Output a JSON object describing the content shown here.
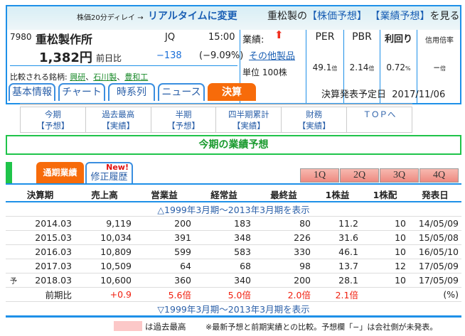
{
  "header": {
    "delay_note": "株価20分ディレイ →",
    "realtime_link": "リアルタイムに変更",
    "view_prefix": "重松製の",
    "stock_forecast_link": "【株価予想】",
    "earnings_forecast_link": "【業績予想】",
    "view_suffix": "を見る"
  },
  "stock": {
    "code": "7980",
    "name": "重松製作所",
    "market": "JQ",
    "time": "15:00",
    "price": "1,382円",
    "change_label": "前日比",
    "change": "−138",
    "change_pct": "(−9.09%)",
    "compare_label": "比較される銘柄:",
    "compare": [
      "興研",
      "石川製",
      "豊和工"
    ],
    "sep": "、"
  },
  "info": {
    "earnings_label": "業績:",
    "sector_link": "その他製品",
    "unit": "単位 100株"
  },
  "metrics": [
    {
      "label": "PER",
      "value": "49.1",
      "unit": "倍"
    },
    {
      "label": "PBR",
      "value": "2.14",
      "unit": "倍"
    },
    {
      "label": "利回り",
      "value": "0.72",
      "unit": "%"
    },
    {
      "label": "信用倍率",
      "value": "−",
      "unit": "倍"
    }
  ],
  "tabs": [
    "基本情報",
    "チャート",
    "時系列",
    "ニュース",
    "決算"
  ],
  "announce": {
    "label": "決算発表予定日",
    "date": "2017/11/06"
  },
  "subnav": [
    [
      "今期",
      "【予想】"
    ],
    [
      "過去最高",
      "【実績】"
    ],
    [
      "半期",
      "【予想】"
    ],
    [
      "四半期累計",
      "【実績】"
    ],
    [
      "財務",
      "【実績】"
    ],
    [
      "ＴＯＰへ",
      ""
    ]
  ],
  "section_title": "今期の業績予想",
  "subtabs": {
    "annual": "通期業績",
    "new": "New!",
    "revisions": "修正履歴"
  },
  "quarters": [
    "1Q",
    "2Q",
    "3Q",
    "4Q"
  ],
  "table": {
    "headers": [
      "決算期",
      "売上高",
      "営業益",
      "経常益",
      "最終益",
      "1株益",
      "1株配",
      "発表日"
    ],
    "expand_top": "△1999年3月期～2013年3月期を表示",
    "rows": [
      [
        "",
        "2014.03",
        "9,119",
        "200",
        "183",
        "80",
        "11.2",
        "10",
        "14/05/09"
      ],
      [
        "",
        "2015.03",
        "10,034",
        "391",
        "348",
        "226",
        "31.6",
        "10",
        "15/05/08"
      ],
      [
        "",
        "2016.03",
        "10,809",
        "599",
        "583",
        "330",
        "46.1",
        "10",
        "16/05/10"
      ],
      [
        "",
        "2017.03",
        "10,509",
        "64",
        "68",
        "98",
        "13.7",
        "12",
        "17/05/09"
      ],
      [
        "予",
        "2018.03",
        "10,600",
        "360",
        "340",
        "200",
        "28.1",
        "10",
        "17/05/09"
      ]
    ],
    "compare_row": [
      "前期比",
      "+0.9",
      "5.6倍",
      "5.0倍",
      "2.0倍",
      "2.1倍",
      "",
      "(%)"
    ],
    "expand_bottom": "▽1999年3月期～2013年3月期を表示"
  },
  "footer": {
    "legend": "は過去最高",
    "note": "※最新予想と前期実績との比較。予想欄「−」は会社側が未発表。"
  }
}
